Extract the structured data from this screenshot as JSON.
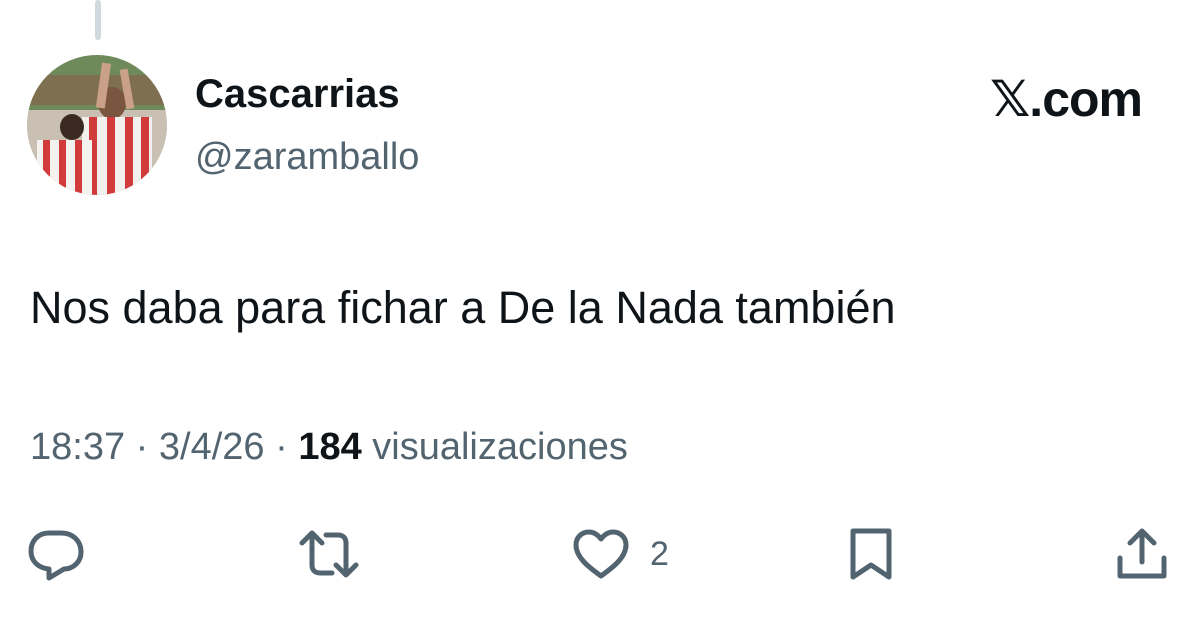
{
  "author": {
    "display_name": "Cascarrias",
    "handle": "@zaramballo"
  },
  "brand": {
    "prefix": "𝕏",
    "suffix": ".com"
  },
  "tweet": {
    "text": "Nos daba para fichar a De la Nada también"
  },
  "meta": {
    "time": "18:37",
    "separator1": " · ",
    "date": "3/4/26",
    "separator2": " · ",
    "views_count": "184",
    "views_label": " visualizaciones"
  },
  "actions": {
    "reply_icon": "reply-icon",
    "retweet_icon": "retweet-icon",
    "like_icon": "heart-icon",
    "like_count": "2",
    "bookmark_icon": "bookmark-icon",
    "share_icon": "share-icon"
  },
  "colors": {
    "text_primary": "#0f1419",
    "text_secondary": "#536471",
    "thread_line": "#cfd9de",
    "background": "#ffffff"
  }
}
